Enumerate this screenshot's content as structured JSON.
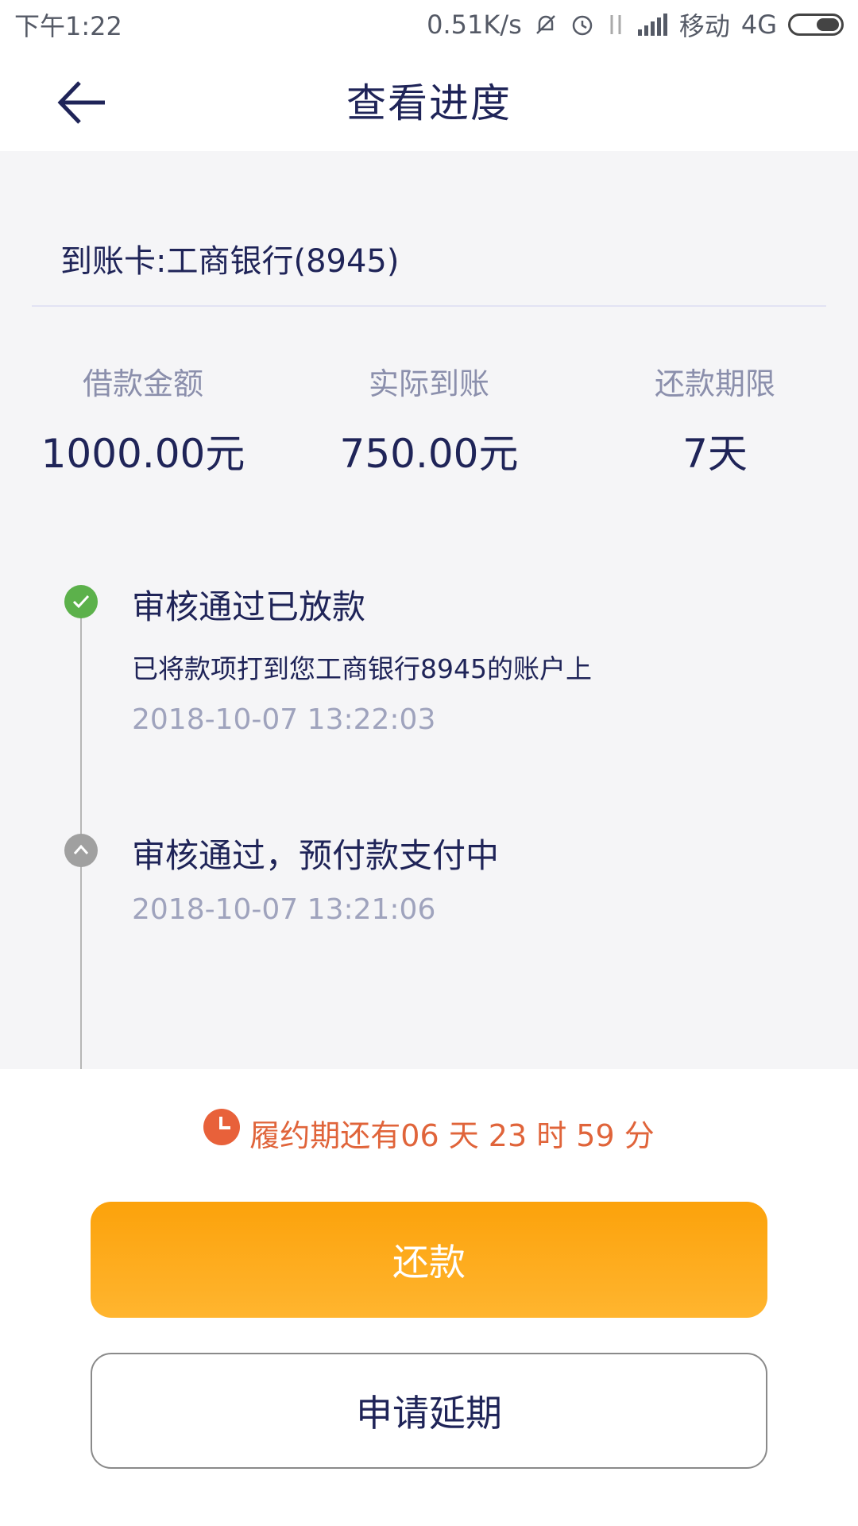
{
  "status_bar": {
    "time": "下午1:22",
    "speed": "0.51K/s",
    "carrier": "移动",
    "network": "4G",
    "icons": [
      "mute-icon",
      "alarm-icon",
      "data-arrows-icon",
      "signal-icon",
      "battery-icon"
    ]
  },
  "header": {
    "title": "查看进度",
    "back_icon": "back-arrow-icon"
  },
  "account": {
    "card_text": "到账卡:工商银行(8945)"
  },
  "stats": [
    {
      "label": "借款金额",
      "value": "1000.00元"
    },
    {
      "label": "实际到账",
      "value": "750.00元"
    },
    {
      "label": "还款期限",
      "value": "7天"
    }
  ],
  "timeline": [
    {
      "title": "审核通过已放款",
      "description": "已将款项打到您工商银行8945的账户上",
      "time": "2018-10-07 13:22:03",
      "status": "done",
      "color": "#5cb14b"
    },
    {
      "title": "审核通过，预付款支付中",
      "time": "2018-10-07 13:21:06",
      "status": "pending",
      "color": "#a0a0a0"
    }
  ],
  "countdown": {
    "text": "履约期还有06 天 23 时 59 分",
    "color": "#e0643a"
  },
  "buttons": {
    "repay": "还款",
    "extend": "申请延期"
  },
  "colors": {
    "primary_text": "#1f2458",
    "accent_orange": "#fca20b",
    "success_green": "#5cb14b"
  }
}
